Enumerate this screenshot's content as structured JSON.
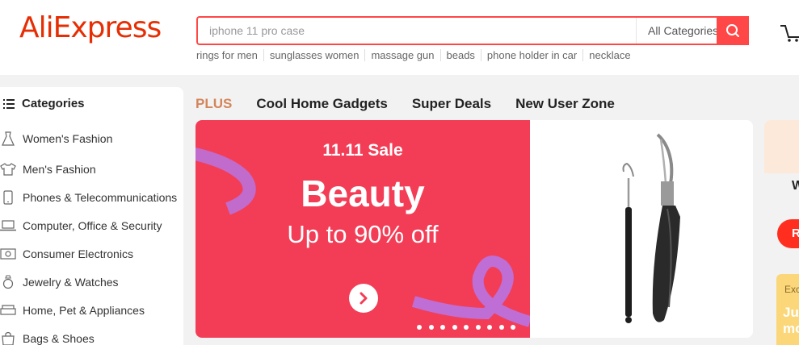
{
  "header": {
    "logo": "AliExpress",
    "search_placeholder": "iphone 11 pro case",
    "category_select": "All Categories",
    "hot_searches": [
      "rings for men",
      "sunglasses women",
      "massage gun",
      "beads",
      "phone holder in car",
      "necklace"
    ]
  },
  "sidebar": {
    "title": "Categories",
    "items": [
      {
        "label": "Women's Fashion",
        "icon": "dress-icon"
      },
      {
        "label": "Men's Fashion",
        "icon": "shirt-icon"
      },
      {
        "label": "Phones & Telecommunications",
        "icon": "phone-icon"
      },
      {
        "label": "Computer, Office & Security",
        "icon": "laptop-icon"
      },
      {
        "label": "Consumer Electronics",
        "icon": "camera-icon"
      },
      {
        "label": "Jewelry & Watches",
        "icon": "ring-icon"
      },
      {
        "label": "Home, Pet & Appliances",
        "icon": "sofa-icon"
      },
      {
        "label": "Bags & Shoes",
        "icon": "bag-icon"
      }
    ]
  },
  "tabs": [
    "PLUS",
    "Cool Home Gadgets",
    "Super Deals",
    "New User Zone"
  ],
  "banner": {
    "sale_label": "11.11 Sale",
    "title": "Beauty",
    "subtitle": "Up to 90% off",
    "slide_count": 9
  },
  "right_panel": {
    "heading_partial": "W",
    "button_partial": "R",
    "card_label_partial": "Exc",
    "card_title_line1": "Jus",
    "card_title_line2": "mo"
  },
  "colors": {
    "brand": "#e62e04",
    "search_border": "#ff4747",
    "banner_red": "#f33d56",
    "plus_tab": "#d4855a"
  }
}
